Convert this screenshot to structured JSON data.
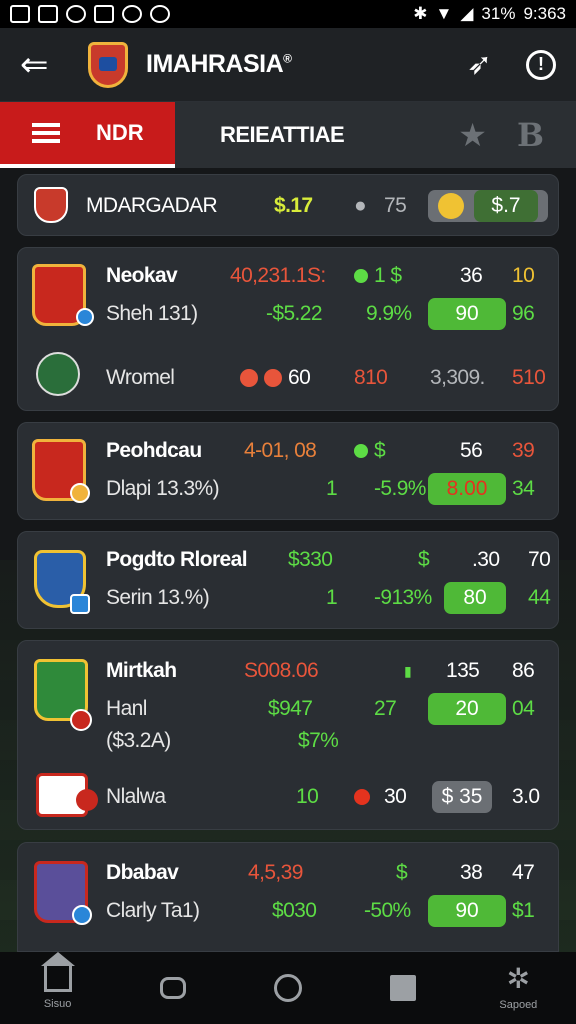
{
  "status_bar": {
    "time": "9:363",
    "battery": "31%"
  },
  "app_bar": {
    "title": "IMAHRASIA",
    "title_mark": "®"
  },
  "tabs": {
    "active_label": "NDR",
    "second_label": "REIEATTIAE",
    "b_label": "B"
  },
  "summary": {
    "name": "MDARGADAR",
    "value": "$.17",
    "count": "75",
    "pill": "$.7"
  },
  "cards": [
    {
      "rows": [
        {
          "name": "Neokav",
          "c1": "40,231.1S:",
          "c2": "1 $",
          "c3": "36",
          "c4": "10"
        },
        {
          "name": "Sheh 131)",
          "c1": "-$5.22",
          "c2": "9.9%",
          "c3": "90",
          "c4": "96"
        },
        {
          "name": "Wromel",
          "c1": "60",
          "c2": "810",
          "c3": "3,309.",
          "c4": "510"
        }
      ]
    },
    {
      "rows": [
        {
          "name": "Peohdcau",
          "c1": "4-01, 08",
          "c2": "$",
          "c3": "56",
          "c4": "39"
        },
        {
          "name": "Dlapi 13.3%)",
          "c1": "1",
          "c2": "-5.9%",
          "c3": "8.00",
          "c4": "34"
        }
      ]
    },
    {
      "rows": [
        {
          "name": "Pogdto Rloreal",
          "c1": "$330",
          "c2": "$",
          "c3": ".30",
          "c4": "70"
        },
        {
          "name": "Serin 13.%)",
          "c1": "1",
          "c2": "-913%",
          "c3": "80",
          "c4": "44"
        }
      ]
    },
    {
      "rows": [
        {
          "name": "Mirtkah",
          "c1": "S008.06",
          "c2": "135",
          "c4": "86"
        },
        {
          "name": "Hanl",
          "c1": "$947",
          "c2": "27",
          "c3": "20",
          "c4": "04"
        },
        {
          "name": "($3.2A)",
          "c1": "$7%"
        },
        {
          "name": "Nlalwa",
          "c1": "10",
          "c2": "30",
          "c3": "$ 35",
          "c4": "3.0"
        }
      ]
    },
    {
      "rows": [
        {
          "name": "Dbabav",
          "c1": "4,5,39",
          "c2": "$",
          "c3": "38",
          "c4": "47"
        },
        {
          "name": "Clarly Ta1)",
          "c1": "$030",
          "c2": "-50%",
          "c3": "90",
          "c4": "$1"
        }
      ]
    }
  ],
  "bottom_nav": {
    "home_caption": "Sisuo",
    "right_caption": "Sapoed"
  }
}
